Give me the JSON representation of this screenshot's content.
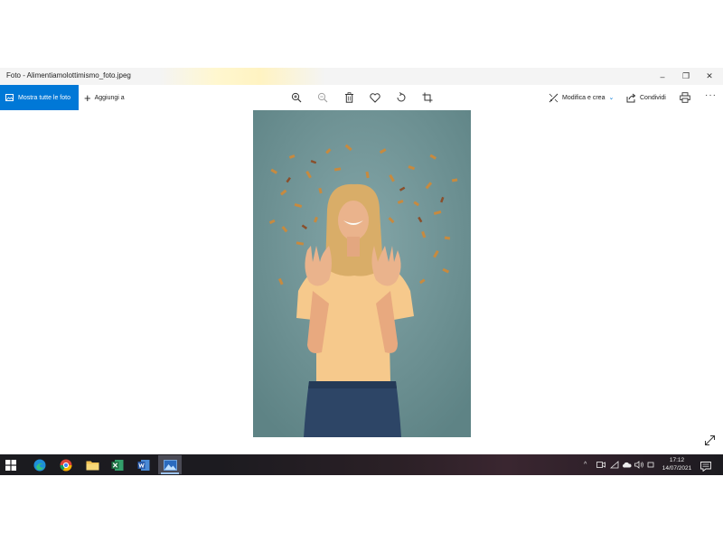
{
  "window": {
    "title": "Foto - Alimentiamolottimismo_foto.jpeg",
    "controls": {
      "minimize": "–",
      "restore": "❐",
      "close": "✕"
    }
  },
  "toolbar": {
    "show_all_label": "Mostra tutte le foto",
    "add_to_label": "Aggiungi a",
    "edit_create_label": "Modifica e crea",
    "share_label": "Condividi",
    "more_label": "···",
    "icons": [
      "zoom-in-icon",
      "zoom-out-icon",
      "trash-icon",
      "heart-icon",
      "rotate-icon",
      "crop-icon",
      "edit-create-icon",
      "share-icon",
      "print-icon",
      "more-icon"
    ],
    "accent_color": "#0078d7"
  },
  "photo": {
    "background_color": "#6d9294",
    "subject": "woman-with-pasta-confetti"
  },
  "taskbar": {
    "apps": [
      "start-icon",
      "edge-icon",
      "chrome-icon",
      "file-explorer-icon",
      "excel-icon",
      "word-icon",
      "photos-icon"
    ],
    "active_app": "photos-icon",
    "tray": {
      "chevron": "^",
      "clock_time": "17:12",
      "clock_date": "14/07/2021",
      "notification_count": "1"
    }
  }
}
